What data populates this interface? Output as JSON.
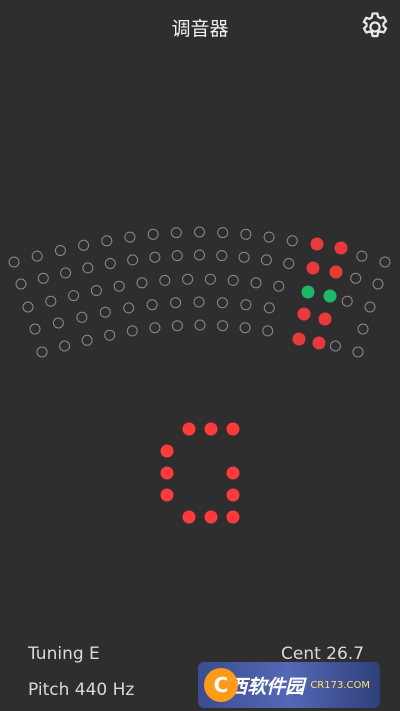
{
  "header": {
    "title": "调音器",
    "settings_icon": "gear-icon"
  },
  "meter": {
    "dot_outline_color": "#8a8a8a",
    "active_color": "#e8393c",
    "in_tune_color": "#1fb866"
  },
  "note": {
    "name": "G",
    "color": "#ff3a3a"
  },
  "readout": {
    "tuning": "Tuning E",
    "pitch": "Pitch 440 Hz",
    "cent": "Cent 26.7"
  },
  "watermark": {
    "brand": "西西软件园",
    "site": "CR173.COM",
    "logo_letter": "C"
  }
}
